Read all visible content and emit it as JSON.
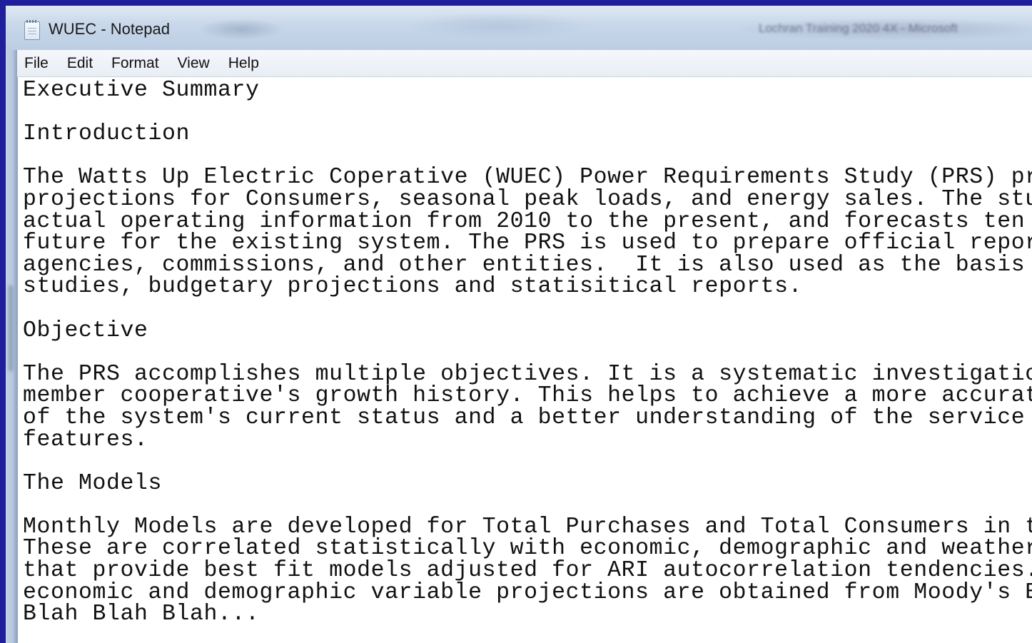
{
  "window": {
    "title": "WUEC - Notepad",
    "background_title": "Lochran Training 2020 4X - Microsoft"
  },
  "menu": [
    "File",
    "Edit",
    "Format",
    "View",
    "Help"
  ],
  "document": {
    "lines": [
      "Executive Summary",
      "",
      "Introduction",
      "",
      "The Watts Up Electric Coperative (WUEC) Power Requirements Study (PRS) pro",
      "projections for Consumers, seasonal peak loads, and energy sales. The stud",
      "actual operating information from 2010 to the present, and forecasts ten y",
      "future for the existing system. The PRS is used to prepare official report",
      "agencies, commissions, and other entities.  It is also used as the basis f",
      "studies, budgetary projections and statisitical reports.",
      "",
      "Objective",
      "",
      "The PRS accomplishes multiple objectives. It is a systematic investigation",
      "member cooperative's growth history. This helps to achieve a more accurate",
      "of the system's current status and a better understanding of the service a",
      "features.",
      "",
      "The Models",
      "",
      "Monthly Models are developed for Total Purchases and Total Consumers in th",
      "These are correlated statistically with economic, demographic and weather ",
      "that provide best fit models adjusted for ARI autocorrelation tendencies. ",
      "economic and demographic variable projections are obtained from Moody's Ec",
      "Blah Blah Blah..."
    ]
  }
}
